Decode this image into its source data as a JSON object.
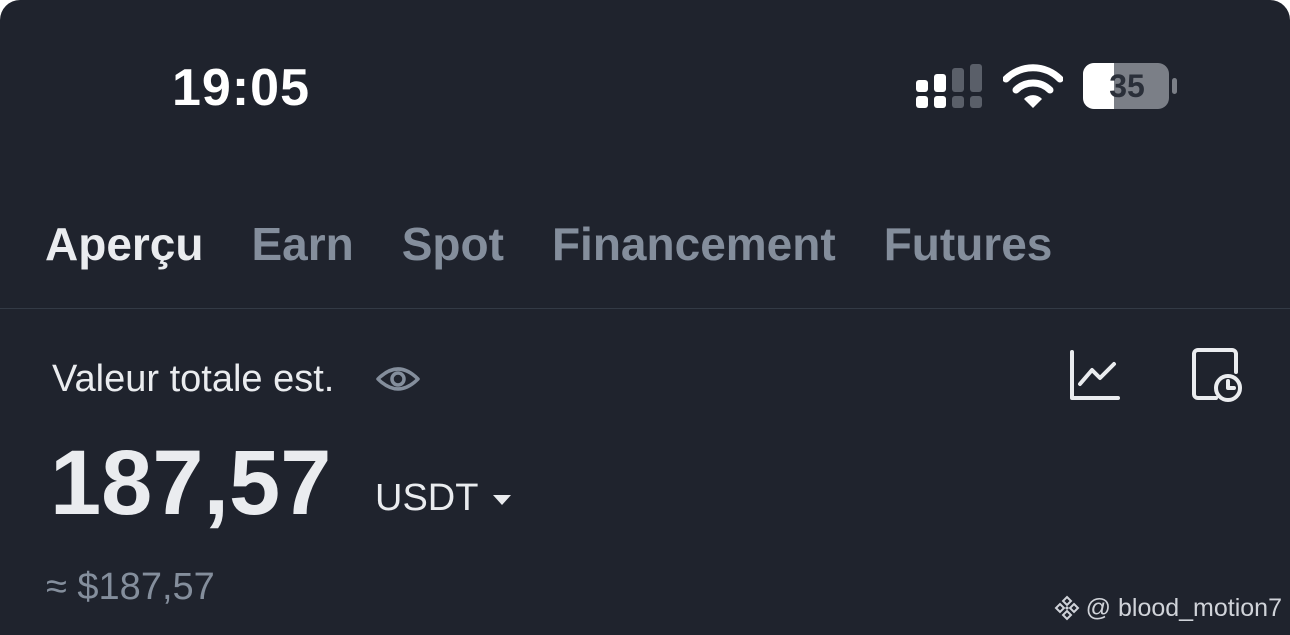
{
  "status_bar": {
    "time": "19:05",
    "battery_level": "35",
    "icons": [
      "signal-icon",
      "wifi-icon",
      "battery-icon"
    ]
  },
  "tabs": [
    {
      "label": "Aperçu",
      "active": true
    },
    {
      "label": "Earn",
      "active": false
    },
    {
      "label": "Spot",
      "active": false
    },
    {
      "label": "Financement",
      "active": false
    },
    {
      "label": "Futures",
      "active": false
    }
  ],
  "balance": {
    "label": "Valeur totale est.",
    "amount": "187,57",
    "currency": "USDT",
    "approx": "≈ $187,57",
    "icons": [
      "eye-icon",
      "pnl-chart-icon",
      "history-icon",
      "caret-down-icon"
    ]
  },
  "watermark": {
    "handle": "@ blood_motion7",
    "logo_icon": "binance-logo-icon"
  },
  "colors": {
    "background": "#1f232d",
    "text_primary": "#eaecef",
    "text_secondary": "#848e9c",
    "divider": "#333a45"
  }
}
